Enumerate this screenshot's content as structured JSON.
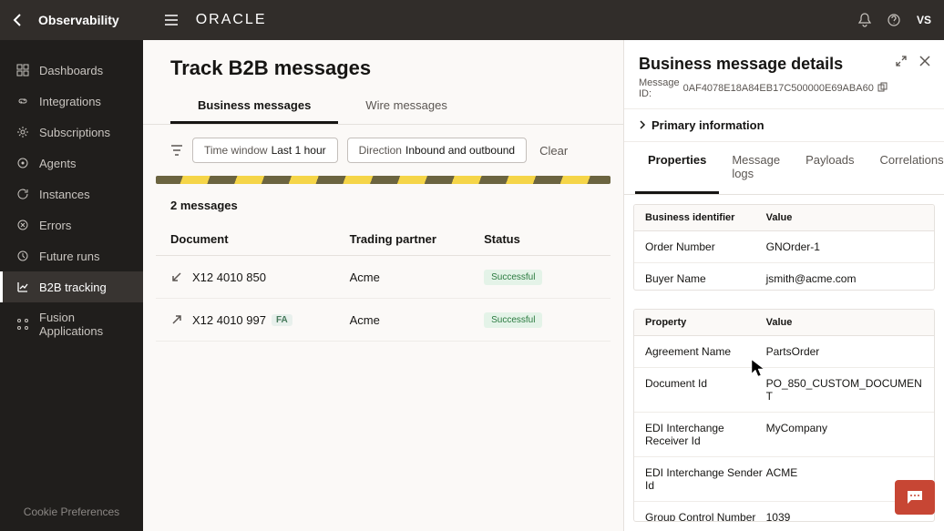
{
  "topbar": {
    "title": "Observability",
    "logo": "ORACLE",
    "user": "VS"
  },
  "sidebar": {
    "items": [
      {
        "label": "Dashboards"
      },
      {
        "label": "Integrations"
      },
      {
        "label": "Subscriptions"
      },
      {
        "label": "Agents"
      },
      {
        "label": "Instances"
      },
      {
        "label": "Errors"
      },
      {
        "label": "Future runs"
      },
      {
        "label": "B2B tracking"
      },
      {
        "label": "Fusion Applications"
      }
    ],
    "cookie": "Cookie Preferences"
  },
  "page": {
    "title": "Track B2B messages",
    "tabs": {
      "business": "Business messages",
      "wire": "Wire messages"
    },
    "filters": {
      "time_label": "Time window",
      "time_value": "Last 1 hour",
      "dir_label": "Direction",
      "dir_value": "Inbound and outbound",
      "clear": "Clear"
    },
    "count": "2 messages",
    "columns": {
      "doc": "Document",
      "tp": "Trading partner",
      "status": "Status"
    },
    "rows": [
      {
        "doc": "X12 4010 850",
        "tp": "Acme",
        "status": "Successful",
        "fa": false,
        "inbound": true
      },
      {
        "doc": "X12 4010 997",
        "tp": "Acme",
        "status": "Successful",
        "fa": true,
        "inbound": false
      }
    ],
    "fa_badge": "FA"
  },
  "details": {
    "title": "Business message details",
    "msgid_label": "Message ID:",
    "msgid": "0AF4078E18A84EB17C500000E69ABA60",
    "primary": "Primary information",
    "tabs": {
      "props": "Properties",
      "logs": "Message logs",
      "payloads": "Payloads",
      "corr": "Correlations"
    },
    "head1": {
      "k": "Business identifier",
      "v": "Value"
    },
    "bi": [
      {
        "k": "Order Number",
        "v": "GNOrder-1"
      },
      {
        "k": "Buyer Name",
        "v": "jsmith@acme.com"
      }
    ],
    "head2": {
      "k": "Property",
      "v": "Value"
    },
    "props": [
      {
        "k": "Agreement Name",
        "v": "PartsOrder"
      },
      {
        "k": "Document Id",
        "v": "PO_850_CUSTOM_DOCUMENT"
      },
      {
        "k": "EDI Interchange Receiver Id",
        "v": "MyCompany"
      },
      {
        "k": "EDI Interchange Sender Id",
        "v": "ACME"
      },
      {
        "k": "Group Control Number",
        "v": "1039"
      }
    ]
  }
}
